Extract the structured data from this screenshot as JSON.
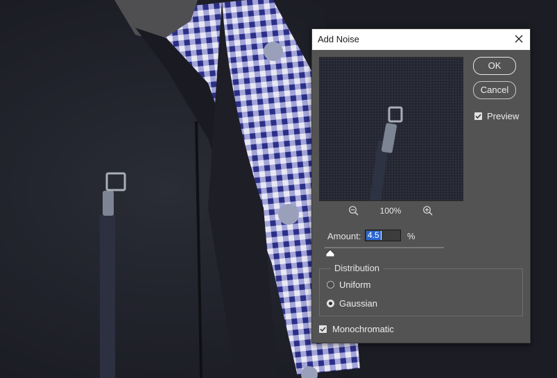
{
  "dialog": {
    "title": "Add Noise",
    "close_icon": "close-icon",
    "ok_label": "OK",
    "cancel_label": "Cancel",
    "preview_label": "Preview",
    "preview_checked": true,
    "zoom_level": "100%",
    "zoom_out_icon": "zoom-out-icon",
    "zoom_in_icon": "zoom-in-icon",
    "amount_label": "Amount:",
    "amount_value": "4.5",
    "amount_unit": "%",
    "amount_slider_fraction": 0.01,
    "distribution": {
      "legend": "Distribution",
      "options": [
        {
          "label": "Uniform",
          "selected": false
        },
        {
          "label": "Gaussian",
          "selected": true
        }
      ]
    },
    "monochromatic_label": "Monochromatic",
    "monochromatic_checked": true
  },
  "colors": {
    "dialog_bg": "#535353",
    "titlebar_bg": "#ffffff",
    "selection": "#2a66d1",
    "jacket": "#1c1e27",
    "shirt_check": "#3a3fa0"
  }
}
